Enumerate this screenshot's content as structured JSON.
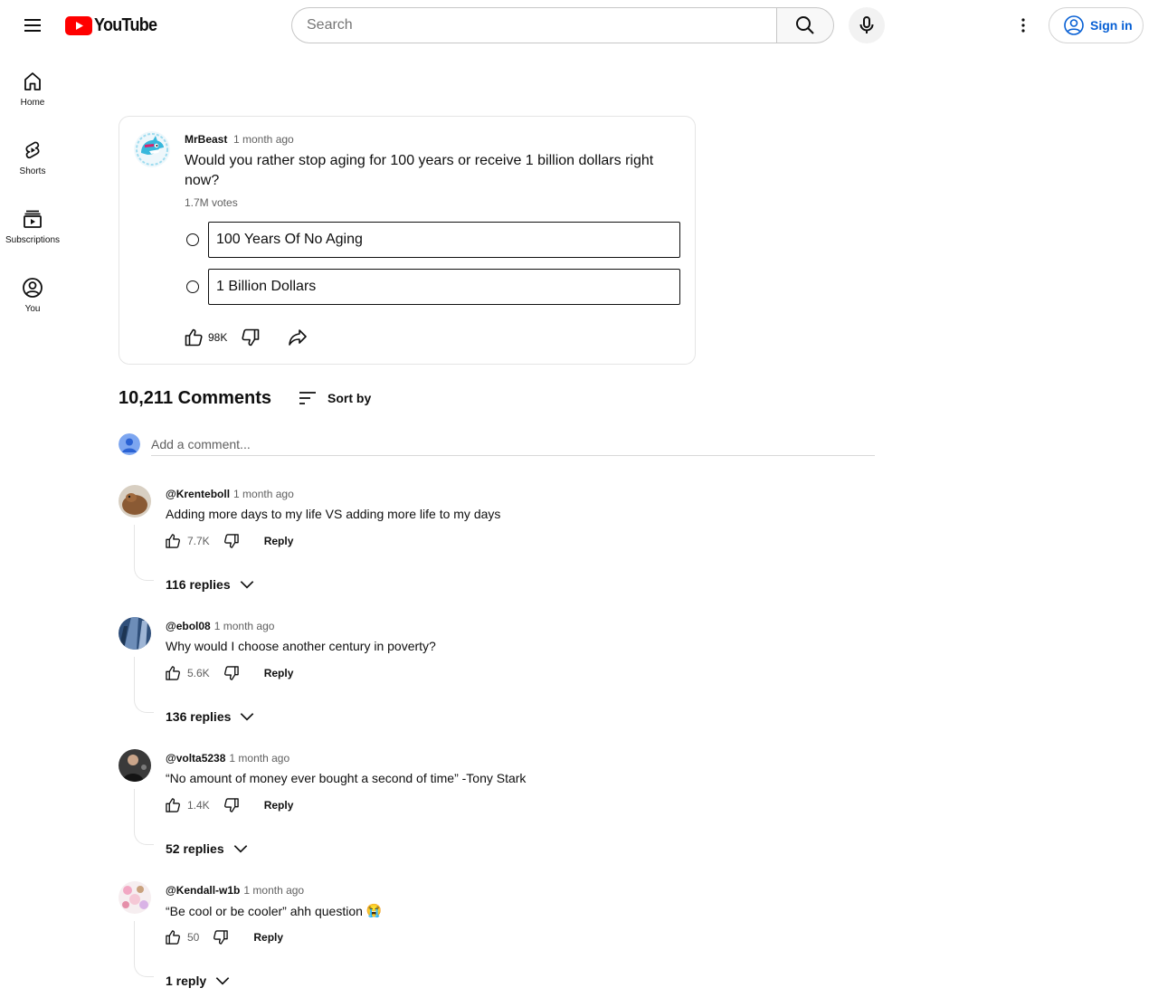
{
  "header": {
    "logo_text": "YouTube",
    "search_placeholder": "Search",
    "signin_label": "Sign in",
    "brand_color": "#ff0000",
    "link_color": "#065fd4"
  },
  "sidebar": {
    "items": [
      {
        "label": "Home",
        "icon": "home-icon"
      },
      {
        "label": "Shorts",
        "icon": "shorts-icon"
      },
      {
        "label": "Subscriptions",
        "icon": "subscriptions-icon"
      },
      {
        "label": "You",
        "icon": "you-icon"
      }
    ]
  },
  "post": {
    "author": "MrBeast",
    "time": "1 month ago",
    "text": "Would you rather stop aging for 100 years or receive 1 billion dollars right now?",
    "votes": "1.7M votes",
    "options": [
      "100 Years Of No Aging",
      "1 Billion Dollars"
    ],
    "likes": "98K"
  },
  "comments_header": {
    "title": "10,211 Comments",
    "sort_label": "Sort by",
    "add_placeholder": "Add a comment..."
  },
  "comments": [
    {
      "author": "@Krenteboll",
      "time": "1 month ago",
      "text": "Adding more days to my life VS adding more life to my days",
      "likes": "7.7K",
      "reply_label": "Reply",
      "replies": "116 replies"
    },
    {
      "author": "@ebol08",
      "time": "1 month ago",
      "text": "Why would I choose another century in poverty?",
      "likes": "5.6K",
      "reply_label": "Reply",
      "replies": "136 replies"
    },
    {
      "author": "@volta5238",
      "time": "1 month ago",
      "text": "“No amount of money ever bought a second of time” -Tony Stark",
      "likes": "1.4K",
      "reply_label": "Reply",
      "replies": "52 replies"
    },
    {
      "author": "@Kendall-w1b",
      "time": "1 month ago",
      "text": "“Be cool or be cooler” ahh question",
      "emoji": "😭",
      "likes": "50",
      "reply_label": "Reply",
      "replies": "1 reply"
    }
  ]
}
